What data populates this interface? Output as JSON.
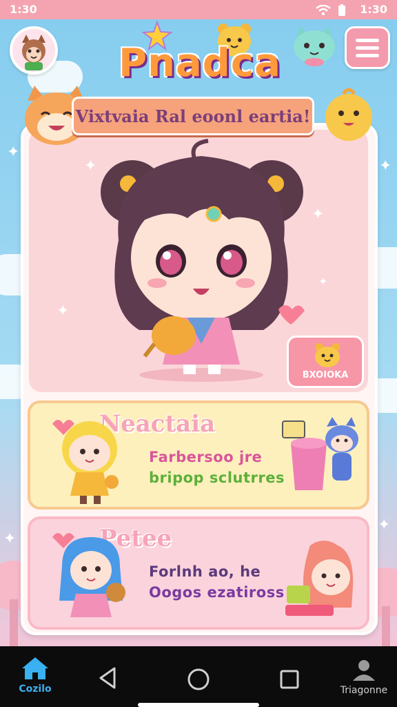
{
  "status_bar": {
    "time_left": "1:30",
    "time_right": "1:30"
  },
  "header": {
    "app_title": "Pnadca",
    "banner_text": "Vixtvaia Ral eoonl eartia!"
  },
  "hero": {
    "badge_label": "BXOIOKA"
  },
  "cards": [
    {
      "title": "Neactaia",
      "line1": "Farbersoo jre",
      "line2": "bripop sclutrres"
    },
    {
      "title": "Petee",
      "line1": "Forlnh ao, he",
      "line2": "Oogos ezatiross"
    }
  ],
  "nav": {
    "home_label": "Cozilo",
    "profile_label": "Triagonne"
  },
  "colors": {
    "accent_pink": "#f39aac",
    "status_bar": "#f4a4b0",
    "card1_bg": "#fdf0bd",
    "card2_bg": "#fbd3dc",
    "nav_bg": "#0c0c0c",
    "home_active": "#3ab0f0"
  },
  "icons": {
    "status": [
      "wifi-icon",
      "battery-icon"
    ],
    "menu": "hamburger-menu-icon",
    "nav": [
      "home-icon",
      "back-icon",
      "circle-home-icon",
      "recent-apps-icon",
      "profile-icon"
    ]
  }
}
